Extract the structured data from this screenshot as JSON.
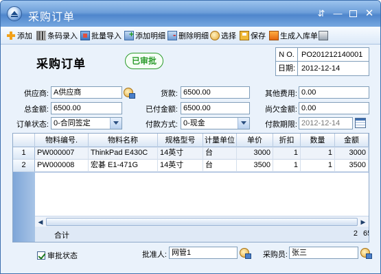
{
  "window": {
    "title": "采购订单"
  },
  "toolbar": {
    "add": "添加",
    "barcode": "条码录入",
    "batch_import": "批量导入",
    "add_detail": "添加明细",
    "delete_detail": "删除明细",
    "select": "选择",
    "save": "保存",
    "generate_inbound": "生成入库单"
  },
  "header": {
    "doc_title": "采购订单",
    "approved_stamp": "已审批",
    "no_label": "N O.",
    "no_value": "PO201212140001",
    "date_label": "日期:",
    "date_value": "2012-12-14"
  },
  "form": {
    "supplier_label": "供应商:",
    "supplier_value": "A供应商",
    "goods_amount_label": "货款:",
    "goods_amount_value": "6500.00",
    "other_fee_label": "其他费用:",
    "other_fee_value": "0.00",
    "total_label": "总金额:",
    "total_value": "6500.00",
    "paid_label": "已付金额:",
    "paid_value": "6500.00",
    "owed_label": "尚欠金额:",
    "owed_value": "0.00",
    "status_label": "订单状态:",
    "status_value": "0-合同签定",
    "pay_method_label": "付款方式:",
    "pay_method_value": "0-现金",
    "pay_due_label": "付款期限:",
    "pay_due_value": "2012-12-14"
  },
  "grid": {
    "columns": [
      "物料编号.",
      "物料名称",
      "规格型号",
      "计量单位",
      "单价",
      "折扣",
      "数量",
      "金额"
    ],
    "rows": [
      {
        "index": "1",
        "code": "PW000007",
        "name": "ThinkPad E430C",
        "spec": "14英寸",
        "unit": "台",
        "price": "3000",
        "discount": "1",
        "qty": "1",
        "amount": "3000"
      },
      {
        "index": "2",
        "code": "PW000008",
        "name": "宏碁  E1-471G",
        "spec": "14英寸",
        "unit": "台",
        "price": "3500",
        "discount": "1",
        "qty": "1",
        "amount": "3500"
      }
    ],
    "total_label": "合计",
    "total_qty": "2",
    "total_amount": "6500"
  },
  "footer": {
    "approval_label": "审批状态",
    "approver_label": "批准人:",
    "approver_value": "网管1",
    "purchaser_label": "采购员:",
    "purchaser_value": "张三"
  }
}
